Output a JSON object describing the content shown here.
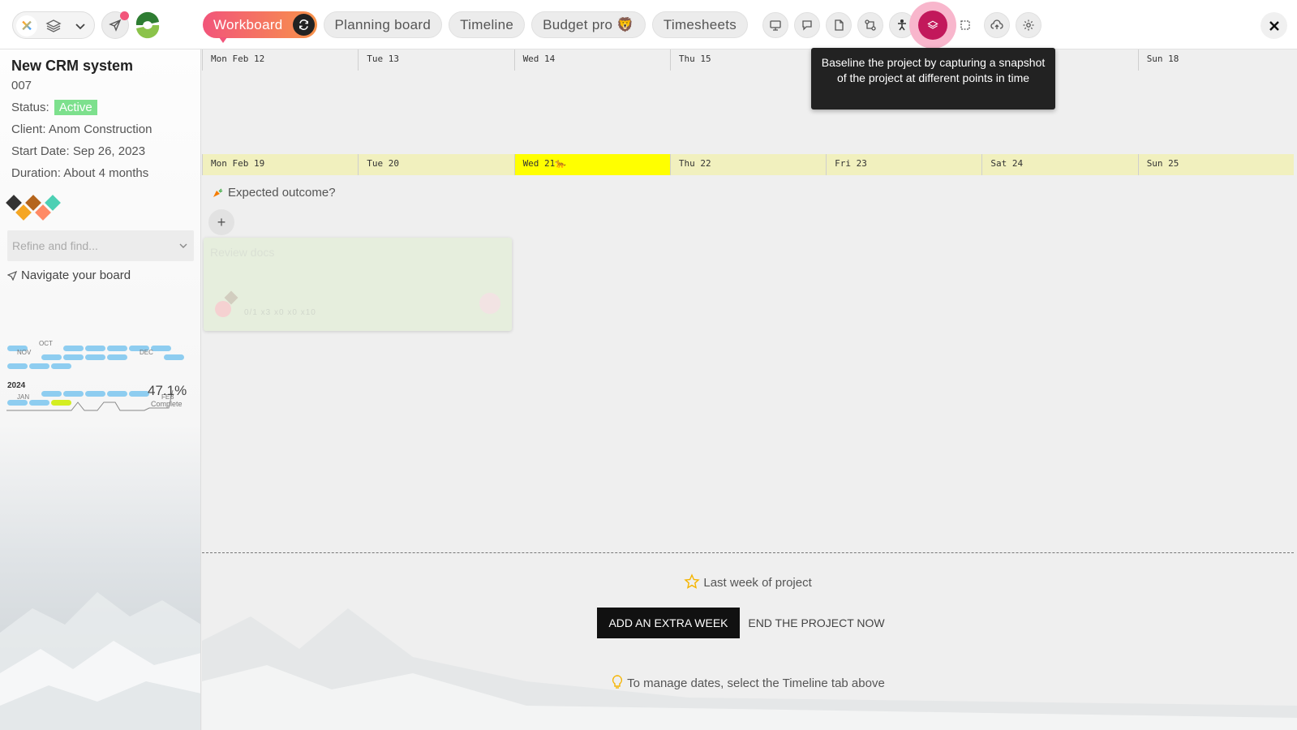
{
  "toolbar": {
    "tabs": [
      {
        "label": "Workboard",
        "active": true
      },
      {
        "label": "Planning board"
      },
      {
        "label": "Timeline"
      },
      {
        "label": "Budget pro 🦁"
      },
      {
        "label": "Timesheets"
      }
    ],
    "tools": [
      "presentation-icon",
      "chat-icon",
      "document-icon",
      "compare-icon",
      "accessibility-icon",
      "baseline-icon",
      "select-area-icon",
      "cloud-upload-icon",
      "gear-icon"
    ],
    "tooltip": "Baseline the project by capturing a snapshot of the project at different points in time",
    "accent_color": "#f2557a"
  },
  "sidebar": {
    "title": "New CRM system",
    "number": "007",
    "status_label": "Status:",
    "status_value": "Active",
    "client": "Client: Anom Construction",
    "start_date": "Start Date: Sep 26, 2023",
    "duration": "Duration: About 4 months",
    "refine_placeholder": "Refine and find...",
    "navigate_label": "Navigate your board",
    "minimap": {
      "months_2023": [
        "OCT",
        "NOV",
        "DEC"
      ],
      "year": "2024",
      "months_2024": [
        "JAN",
        "FEB"
      ]
    },
    "progress_percent": "47.1%",
    "progress_label": "Complete"
  },
  "board": {
    "week1": [
      "Mon Feb 12",
      "Tue 13",
      "Wed 14",
      "Thu 15",
      "",
      "",
      "Sun 18"
    ],
    "week2": [
      "Mon Feb 19",
      "Tue 20",
      "Wed 21🐆",
      "Thu 22",
      "Fri 23",
      "Sat 24",
      "Sun 25"
    ],
    "today_index": 2,
    "expected_outcome": "Expected outcome?",
    "card": {
      "title": "Review docs",
      "meta": "0/1   x3   x0   x0   x10"
    },
    "last_week": "Last week of project",
    "add_week_button": "ADD AN EXTRA WEEK",
    "end_project_button": "END THE PROJECT NOW",
    "hint": "To manage dates, select the Timeline tab above"
  }
}
